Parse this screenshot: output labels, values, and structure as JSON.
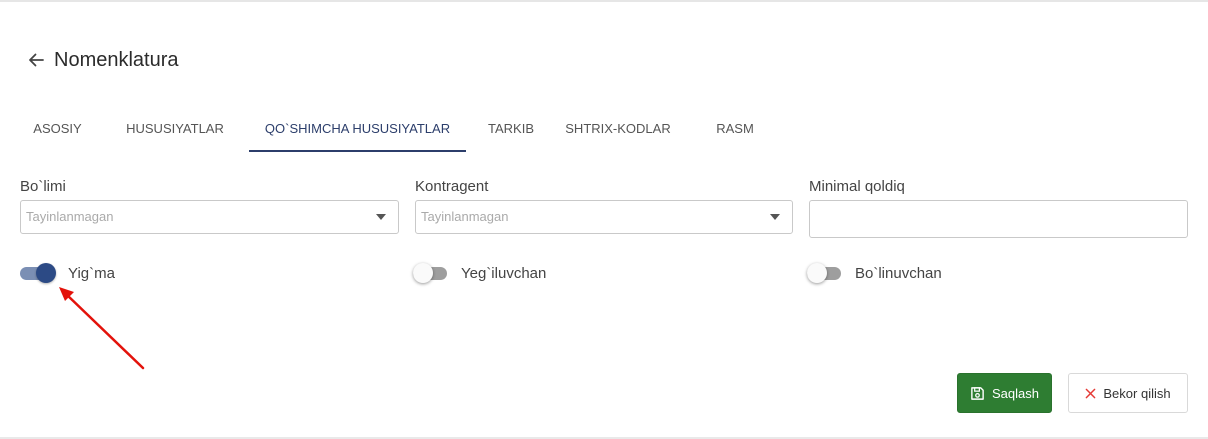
{
  "header": {
    "title": "Nomenklatura",
    "back_icon": "arrow-left-icon"
  },
  "tabs": [
    {
      "label": "ASOSIY",
      "active": false
    },
    {
      "label": "HUSUSIYATLAR",
      "active": false
    },
    {
      "label": "QO`SHIMCHA HUSUSIYATLAR",
      "active": true
    },
    {
      "label": "TARKIB",
      "active": false
    },
    {
      "label": "SHTRIX-KODLAR",
      "active": false
    },
    {
      "label": "RASM",
      "active": false
    }
  ],
  "fields": {
    "bolimi": {
      "label": "Bo`limi",
      "value": "Tayinlanmagan"
    },
    "kontragent": {
      "label": "Kontragent",
      "value": "Tayinlanmagan"
    },
    "minimal_qoldiq": {
      "label": "Minimal qoldiq",
      "value": ""
    }
  },
  "toggles": {
    "yigma": {
      "label": "Yig`ma",
      "checked": true
    },
    "yegiluvchan": {
      "label": "Yeg`iluvchan",
      "checked": false
    },
    "bolinuvchan": {
      "label": "Bo`linuvchan",
      "checked": false
    }
  },
  "actions": {
    "save": {
      "label": "Saqlash",
      "icon": "floppy-disk-icon"
    },
    "cancel": {
      "label": "Bekor qilish",
      "icon": "close-icon"
    }
  },
  "colors": {
    "accent": "#2c3e6b",
    "save_button": "#2e7d32",
    "cancel_icon": "#e53935",
    "annotation_arrow": "#e3120b"
  }
}
